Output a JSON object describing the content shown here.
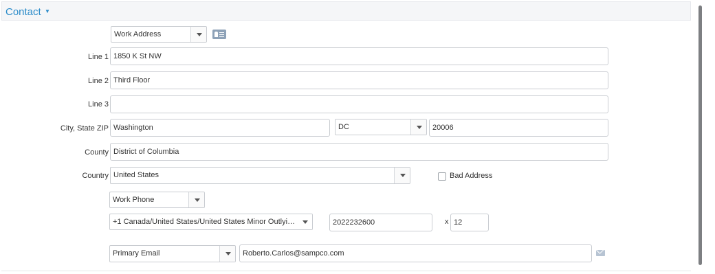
{
  "section": {
    "title": "Contact"
  },
  "address": {
    "type": "Work Address",
    "line1_label": "Line 1",
    "line1": "1850 K St NW",
    "line2_label": "Line 2",
    "line2": "Third Floor",
    "line3_label": "Line 3",
    "line3": "",
    "city_state_zip_label": "City, State ZIP",
    "city": "Washington",
    "state": "DC",
    "zip": "20006",
    "county_label": "County",
    "county": "District of Columbia",
    "country_label": "Country",
    "country": "United States",
    "bad_address_label": "Bad Address",
    "bad_address_checked": false
  },
  "phone": {
    "type": "Work Phone",
    "country_code": "+1 Canada/United States/United States Minor Outlyin...",
    "number": "2022232600",
    "ext_label": "x",
    "ext": "12"
  },
  "email": {
    "type": "Primary Email",
    "address": "Roberto.Carlos@sampco.com"
  },
  "icons": {
    "header_caret": "caret-down-icon",
    "address_card": "address-card-icon",
    "send_email": "envelope-icon"
  },
  "colors": {
    "accent": "#2a8bc9",
    "border": "#c9ccd1",
    "header_bg": "#f5f6f8"
  }
}
